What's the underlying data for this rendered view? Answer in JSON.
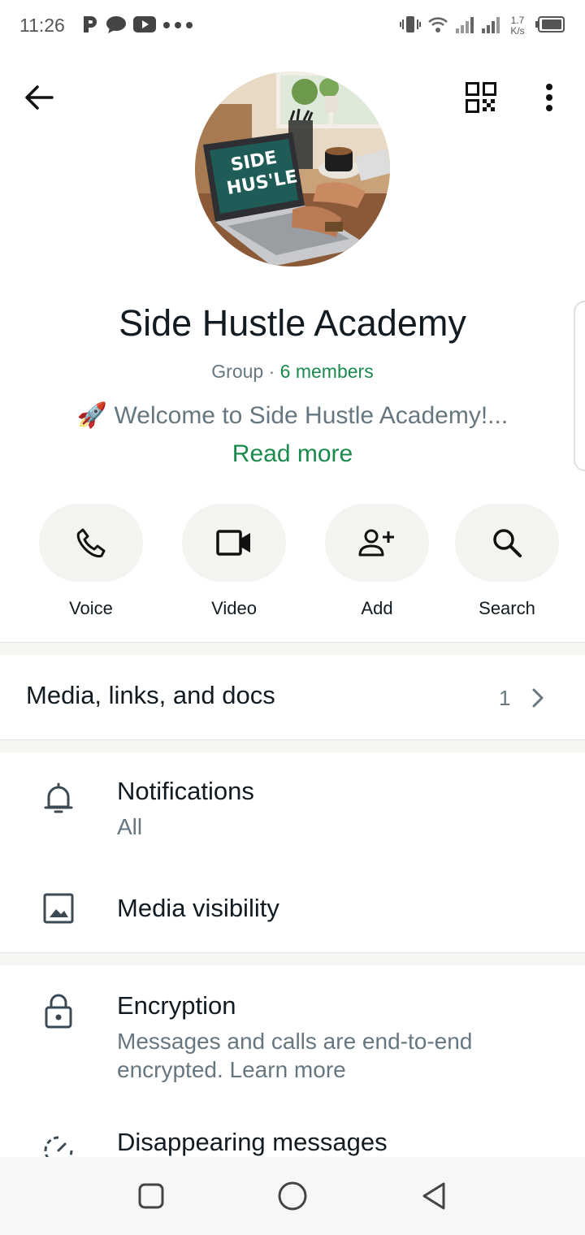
{
  "status_bar": {
    "time": "11:26",
    "net_speed_value": "1.7",
    "net_speed_unit": "K/s",
    "left_icons": [
      "parking-app-icon",
      "chat-bubble-icon",
      "youtube-icon",
      "more-dots-icon"
    ],
    "right_icons": [
      "vibrate-icon",
      "wifi-icon",
      "signal-icon",
      "signal-icon",
      "battery-icon"
    ]
  },
  "avatar": {
    "laptop_text_line1": "SIDE",
    "laptop_text_line2": "HUS'LE"
  },
  "group": {
    "name": "Side Hustle Academy",
    "type": "Group",
    "separator": " · ",
    "members": "6 members",
    "description_emoji": "🚀",
    "description": " Welcome to Side Hustle Academy!...",
    "read_more": "Read more"
  },
  "actions": [
    {
      "label": "Voice",
      "icon": "phone-icon"
    },
    {
      "label": "Video",
      "icon": "video-icon"
    },
    {
      "label": "Add",
      "icon": "add-person-icon"
    },
    {
      "label": "Search",
      "icon": "search-icon"
    }
  ],
  "media": {
    "label": "Media, links, and docs",
    "count": "1"
  },
  "settings": {
    "notifications": {
      "title": "Notifications",
      "subtitle": "All"
    },
    "media_visibility": {
      "title": "Media visibility"
    },
    "encryption": {
      "title": "Encryption",
      "subtitle": "Messages and calls are end-to-end encrypted. Learn more"
    },
    "disappearing": {
      "title": "Disappearing messages"
    }
  },
  "colors": {
    "accent_green": "#1a8a4d",
    "secondary_text": "#667781",
    "action_bg": "#f4f3ef"
  }
}
